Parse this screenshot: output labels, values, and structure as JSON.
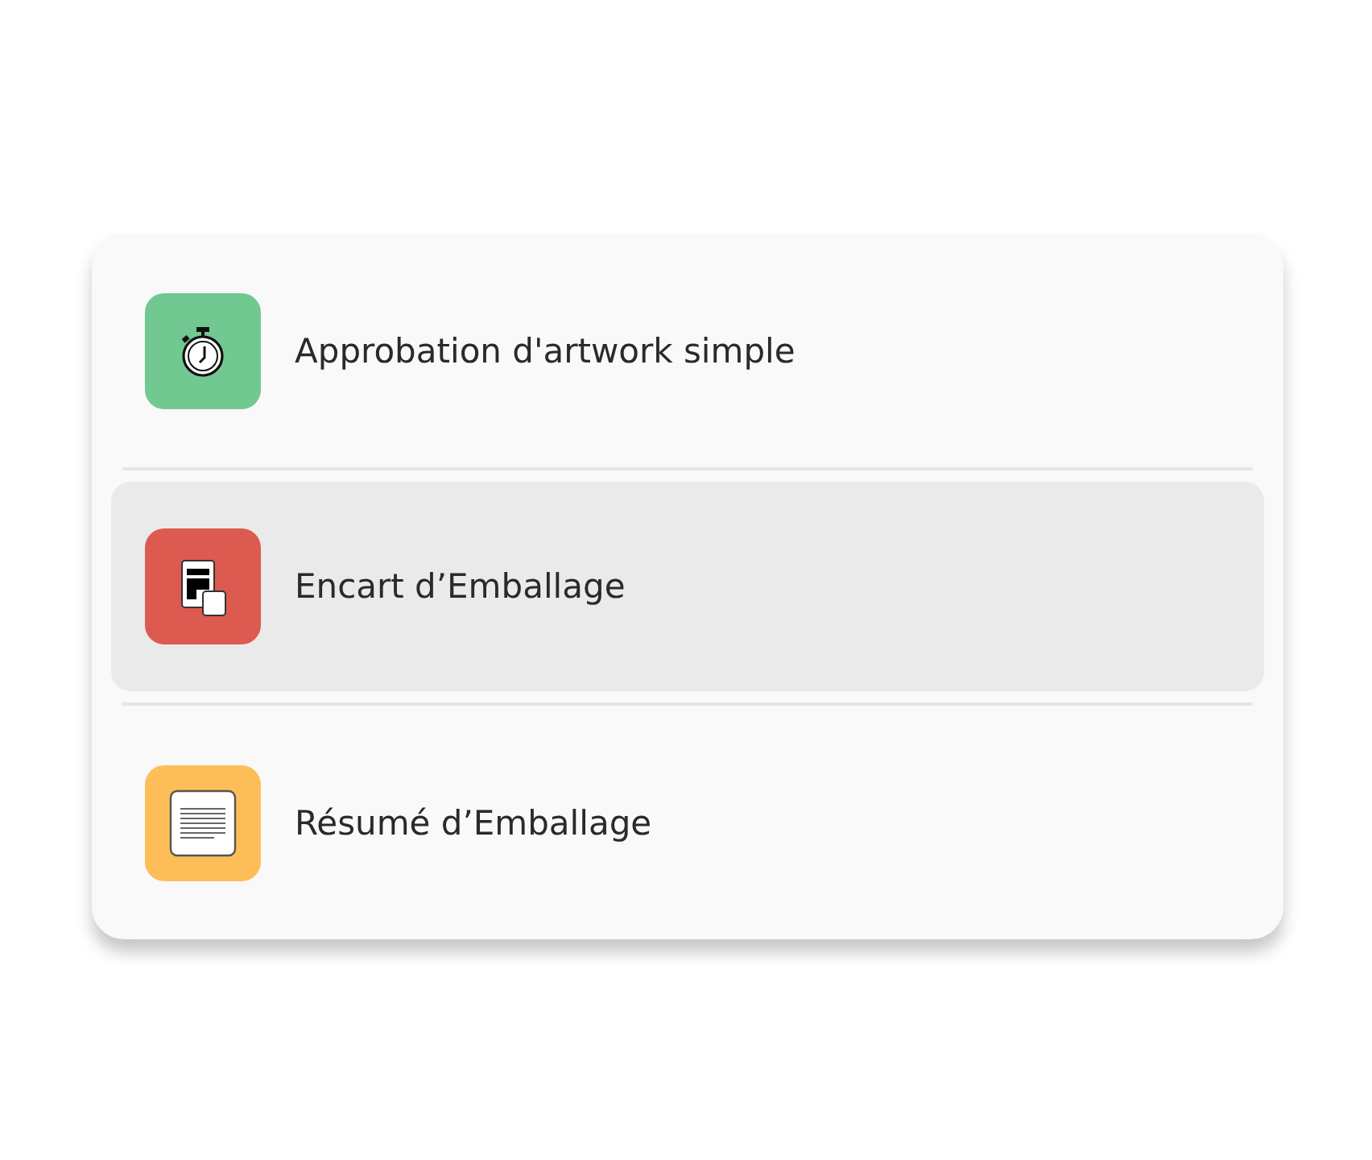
{
  "items": [
    {
      "label": "Approbation d'artwork simple",
      "kind": "stopwatch",
      "color": "#72c891",
      "selected": false
    },
    {
      "label": "Encart d’Emballage",
      "kind": "insert",
      "color": "#dc5a4f",
      "selected": true
    },
    {
      "label": "Résumé d’Emballage",
      "kind": "document",
      "color": "#fdbe5a",
      "selected": false
    }
  ]
}
